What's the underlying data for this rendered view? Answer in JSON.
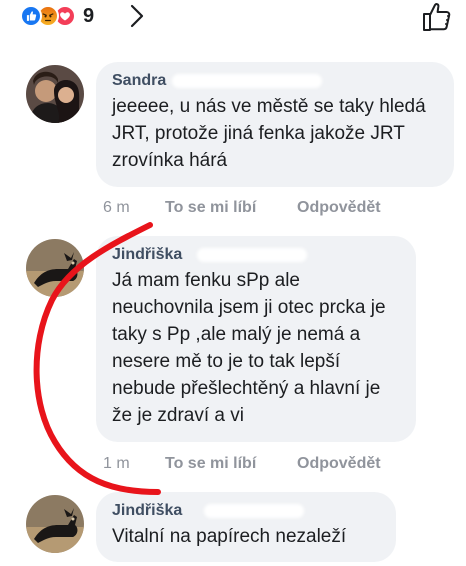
{
  "reactions": {
    "types": [
      "like-icon",
      "angry-icon",
      "love-icon"
    ],
    "count": "9",
    "colors": {
      "like": "#1877f2",
      "angry": "#f0902a",
      "love": "#f33e58"
    }
  },
  "comments": [
    {
      "author": "Sandra",
      "text": "jeeeee, u nás ve městě se taky hledá JRT, protože jiná fenka jakože JRT zrovínka hárá",
      "time": "6 m",
      "like_label": "To se mi líbí",
      "reply_label": "Odpovědět"
    },
    {
      "author": "Jindřiška",
      "text": "Já mam fenku  sPp ale neuchovnila jsem ji otec prcka je taky s Pp ,ale malý je nemá a nesere mě to je to tak lepší nebude přešlechtěný a hlavní je že je zdraví a vi",
      "time": "1 m",
      "like_label": "To se mi líbí",
      "reply_label": "Odpovědět"
    },
    {
      "author": "Jindřiška",
      "text": "Vitalní na papírech nezaleží"
    }
  ],
  "annotation_color": "#e8141b"
}
